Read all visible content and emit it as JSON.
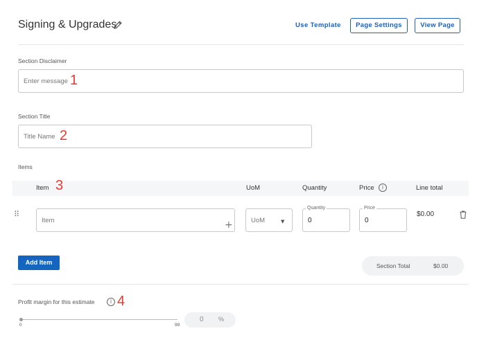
{
  "header": {
    "title": "Signing & Upgrades",
    "use_template": "Use Template",
    "page_settings": "Page Settings",
    "view_page": "View Page"
  },
  "disclaimer": {
    "label": "Section Disclaimer",
    "placeholder": "Enter message",
    "annotation": "1"
  },
  "section_title": {
    "label": "Section Title",
    "placeholder": "Title Name",
    "annotation": "2"
  },
  "items": {
    "label": "Items",
    "annotation": "3",
    "columns": [
      "Item",
      "UoM",
      "Quantity",
      "Price",
      "Line total"
    ],
    "row": {
      "item_placeholder": "Item",
      "uom_value": "UoM",
      "quantity_label": "Quantity",
      "quantity_value": "0",
      "price_label": "Price",
      "price_value": "0",
      "line_total": "$0.00"
    },
    "add_button": "Add Item",
    "section_total_label": "Section Total",
    "section_total_value": "$0.00"
  },
  "profit": {
    "label": "Profit margin for this estimate",
    "annotation": "4",
    "slider_min": "0",
    "slider_max": "99",
    "slider_value": 0,
    "percent_value": "0",
    "percent_unit": "%"
  },
  "colors": {
    "accent": "#1565c0",
    "annotation": "#e53935"
  }
}
